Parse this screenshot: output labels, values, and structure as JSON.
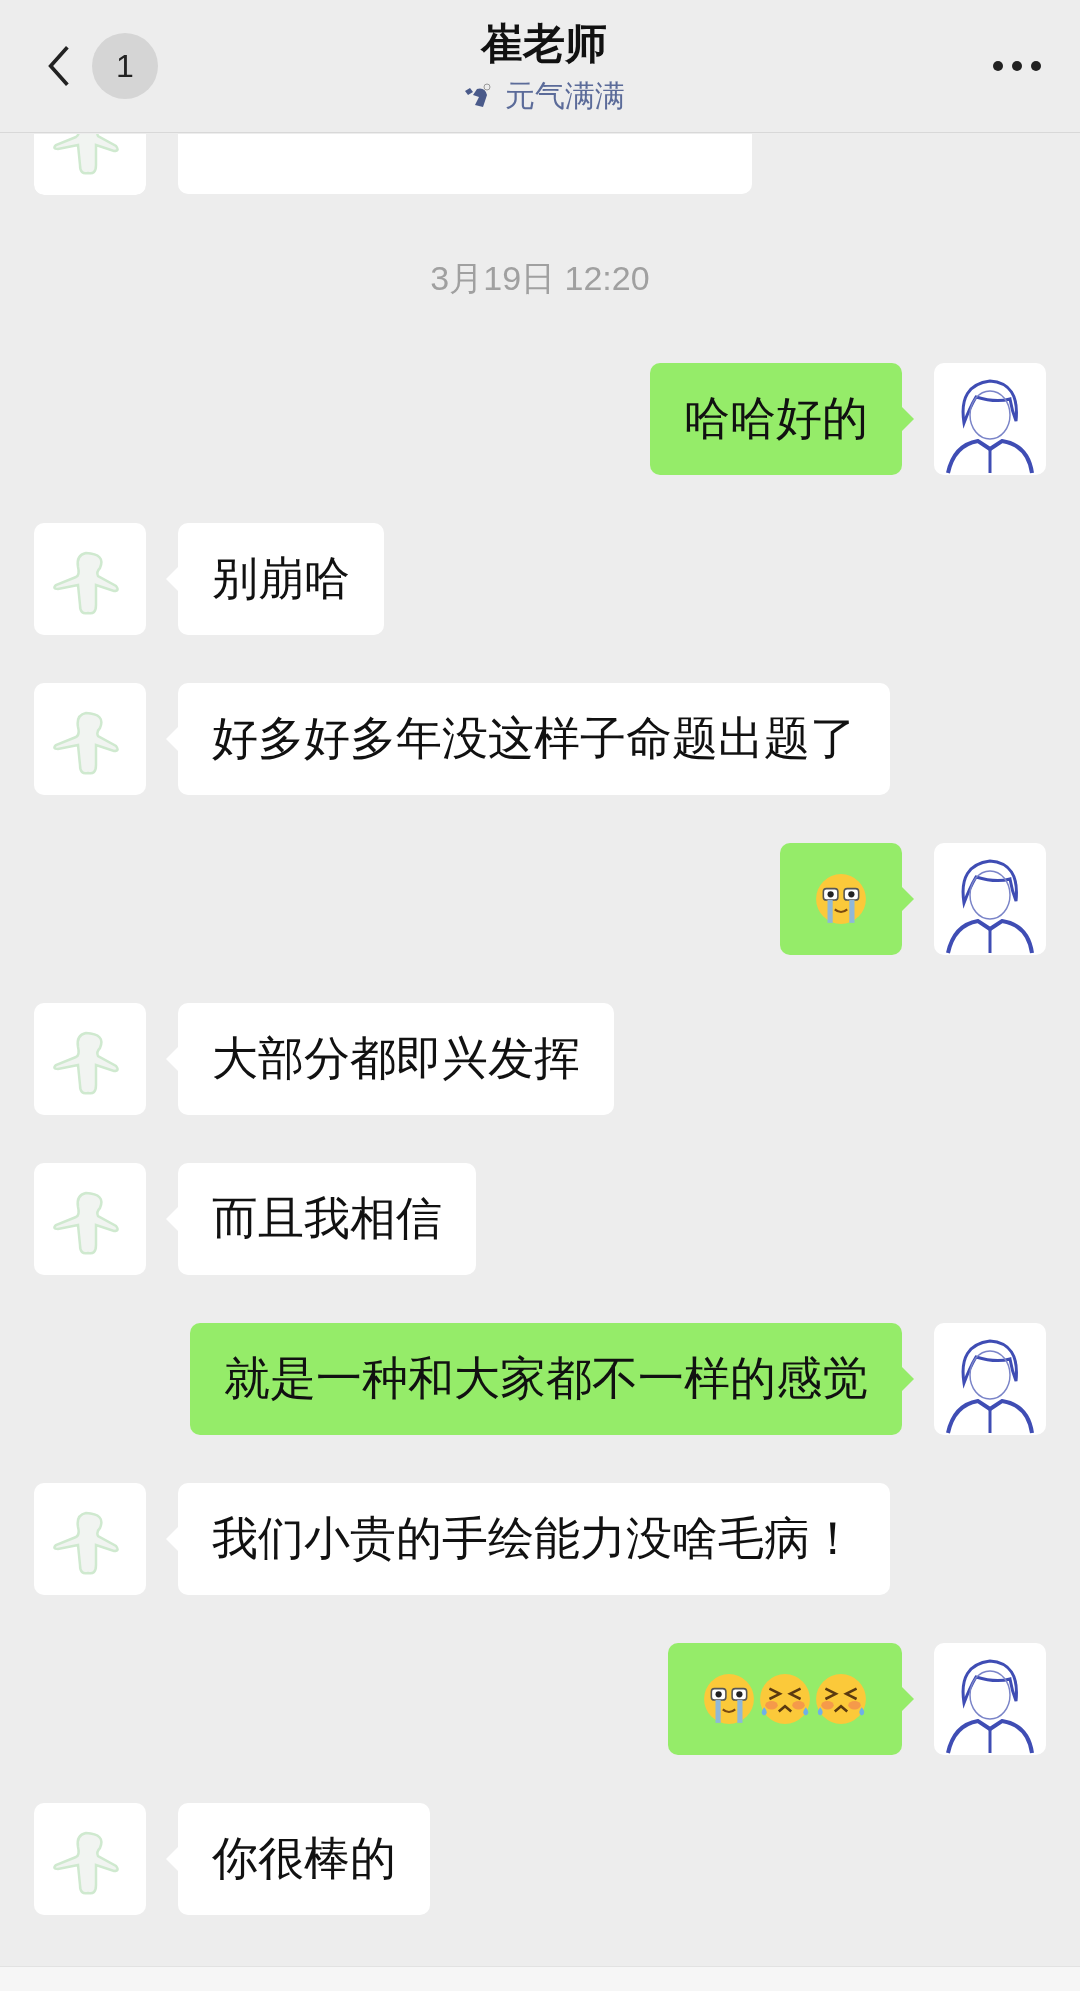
{
  "header": {
    "title": "崔老师",
    "status": "元气满满",
    "unread_badge": "1"
  },
  "messages": [
    {
      "kind": "partial",
      "outgoing": false
    },
    {
      "kind": "timestamp",
      "text": "3月19日 12:20"
    },
    {
      "kind": "text",
      "outgoing": true,
      "text": "哈哈好的"
    },
    {
      "kind": "text",
      "outgoing": false,
      "text": "别崩哈"
    },
    {
      "kind": "text",
      "outgoing": false,
      "text": "好多好多年没这样子命题出题了"
    },
    {
      "kind": "emoji",
      "outgoing": true,
      "emoji": [
        {
          "kind": "tearful"
        }
      ]
    },
    {
      "kind": "text",
      "outgoing": false,
      "text": "大部分都即兴发挥"
    },
    {
      "kind": "text",
      "outgoing": false,
      "text": "而且我相信"
    },
    {
      "kind": "text",
      "outgoing": true,
      "text": "就是一种和大家都不一样的感觉"
    },
    {
      "kind": "text",
      "outgoing": false,
      "text": "我们小贵的手绘能力没啥毛病！"
    },
    {
      "kind": "emoji",
      "outgoing": true,
      "emoji": [
        {
          "kind": "tearful"
        },
        {
          "kind": "squint-tears"
        },
        {
          "kind": "squint-tears"
        }
      ]
    },
    {
      "kind": "text",
      "outgoing": false,
      "text": "你很棒的"
    }
  ]
}
